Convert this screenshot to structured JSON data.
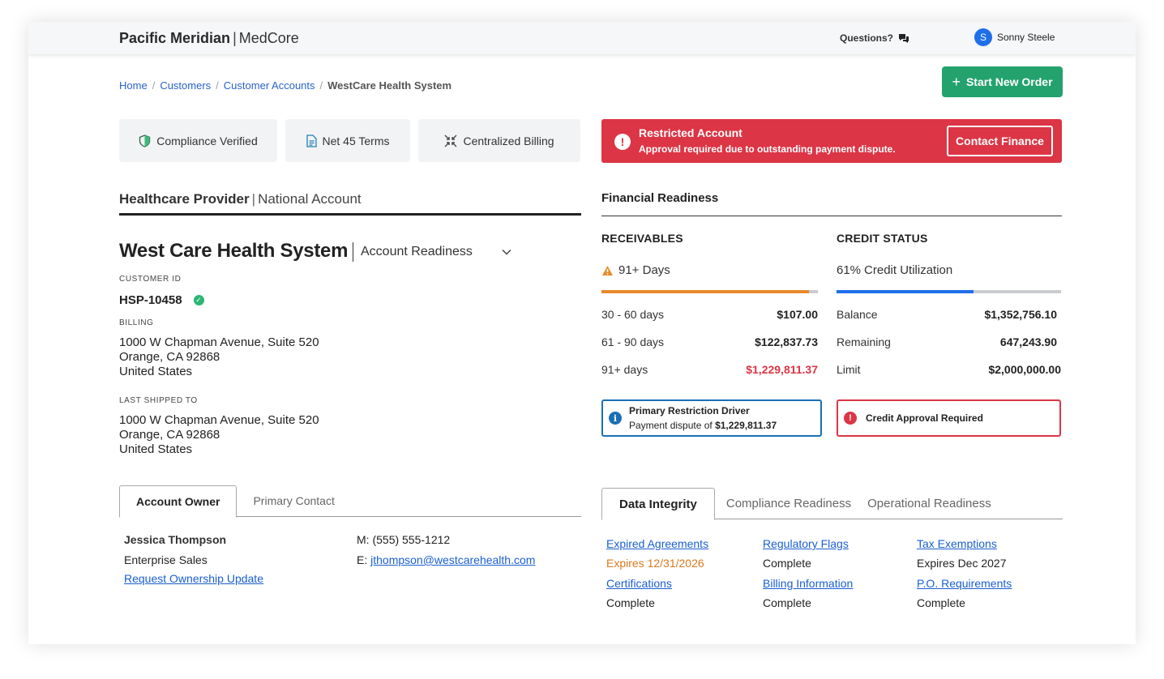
{
  "topbar": {
    "brand": "Pacific Meridian",
    "brand_sep": "|",
    "product": "MedCore",
    "questions": "Questions?",
    "questions_icon": "chat-bubbles-icon",
    "user_initial": "S",
    "user_name": "Sonny Steele"
  },
  "breadcrumb": {
    "items": [
      "Home",
      "Customers",
      "Customer Accounts"
    ],
    "current": "WestCare Health System"
  },
  "actions": {
    "start_new_order": "Start New Order"
  },
  "pills": [
    {
      "label": "Compliance Verified",
      "icon": "shield-icon"
    },
    {
      "label": "Net 45 Terms",
      "icon": "document-icon"
    },
    {
      "label": "Centralized Billing",
      "icon": "arrows-converge-icon"
    }
  ],
  "alert": {
    "title": "Restricted Account",
    "message": "Approval required due to outstanding payment dispute.",
    "button": "Contact Finance",
    "color": "#dc3545"
  },
  "section": {
    "title": "Healthcare Provider",
    "sep": "|",
    "subtitle": "National Account"
  },
  "account": {
    "name": "West Care Health System",
    "readiness_label": "Account Readiness",
    "customer_id_label": "CUSTOMER ID",
    "customer_id": "HSP-10458",
    "billing_label": "BILLING",
    "billing": [
      "1000 W Chapman Avenue, Suite 520",
      "Orange, CA 92868",
      "United States"
    ],
    "shipped_label": "LAST SHIPPED TO",
    "shipped": [
      "1000 W Chapman Avenue, Suite 520",
      "Orange, CA 92868",
      "United States"
    ]
  },
  "owner_tabs": [
    "Account Owner",
    "Primary Contact"
  ],
  "owner": {
    "name": "Jessica Thompson",
    "title": "Enterprise Sales",
    "link": "Request Ownership Update",
    "phone_label": "M:",
    "phone": "(555) 555-1212",
    "email_label": "E:",
    "email": "jthompson@westcarehealth.com"
  },
  "financial": {
    "title": "Financial Readiness",
    "receivables": {
      "title": "RECEIVABLES",
      "summary": "91+ Days",
      "progress": 0.96,
      "color": "#e8892b",
      "rows": [
        {
          "label": "30 - 60 days",
          "value": "$107.00"
        },
        {
          "label": "61 - 90 days",
          "value": "$122,837.73"
        },
        {
          "label": "91+ days",
          "value": "$1,229,811.37"
        }
      ]
    },
    "credit": {
      "title": "CREDIT STATUS",
      "summary_pct": "61%",
      "summary": "Credit Utilization",
      "progress": 0.61,
      "color": "#1f6feb",
      "rows": [
        {
          "label": "Balance",
          "value": "$1,352,756.10"
        },
        {
          "label": "Remaining",
          "value": "647,243.90"
        },
        {
          "label": "Limit",
          "value": "$2,000,000.00"
        }
      ]
    },
    "driver": {
      "title": "Primary Restriction Driver",
      "prefix": "Payment dispute of",
      "amount": "$1,229,811.37"
    },
    "approval": "Credit Approval Required"
  },
  "integrity_tabs": [
    "Data Integrity",
    "Compliance Readiness",
    "Operational Readiness"
  ],
  "integrity": [
    {
      "label": "Expired Agreements",
      "status": "Expires 12/31/2026",
      "warn": true
    },
    {
      "label": "Regulatory Flags",
      "status": "Complete",
      "warn": false
    },
    {
      "label": "Tax Exemptions",
      "status": "Expires Dec 2027",
      "warn": false
    },
    {
      "label": "Certifications",
      "status": "Complete",
      "warn": false
    },
    {
      "label": "Billing Information",
      "status": "Complete",
      "warn": false
    },
    {
      "label": "P.O. Requirements",
      "status": "Complete",
      "warn": false
    }
  ]
}
